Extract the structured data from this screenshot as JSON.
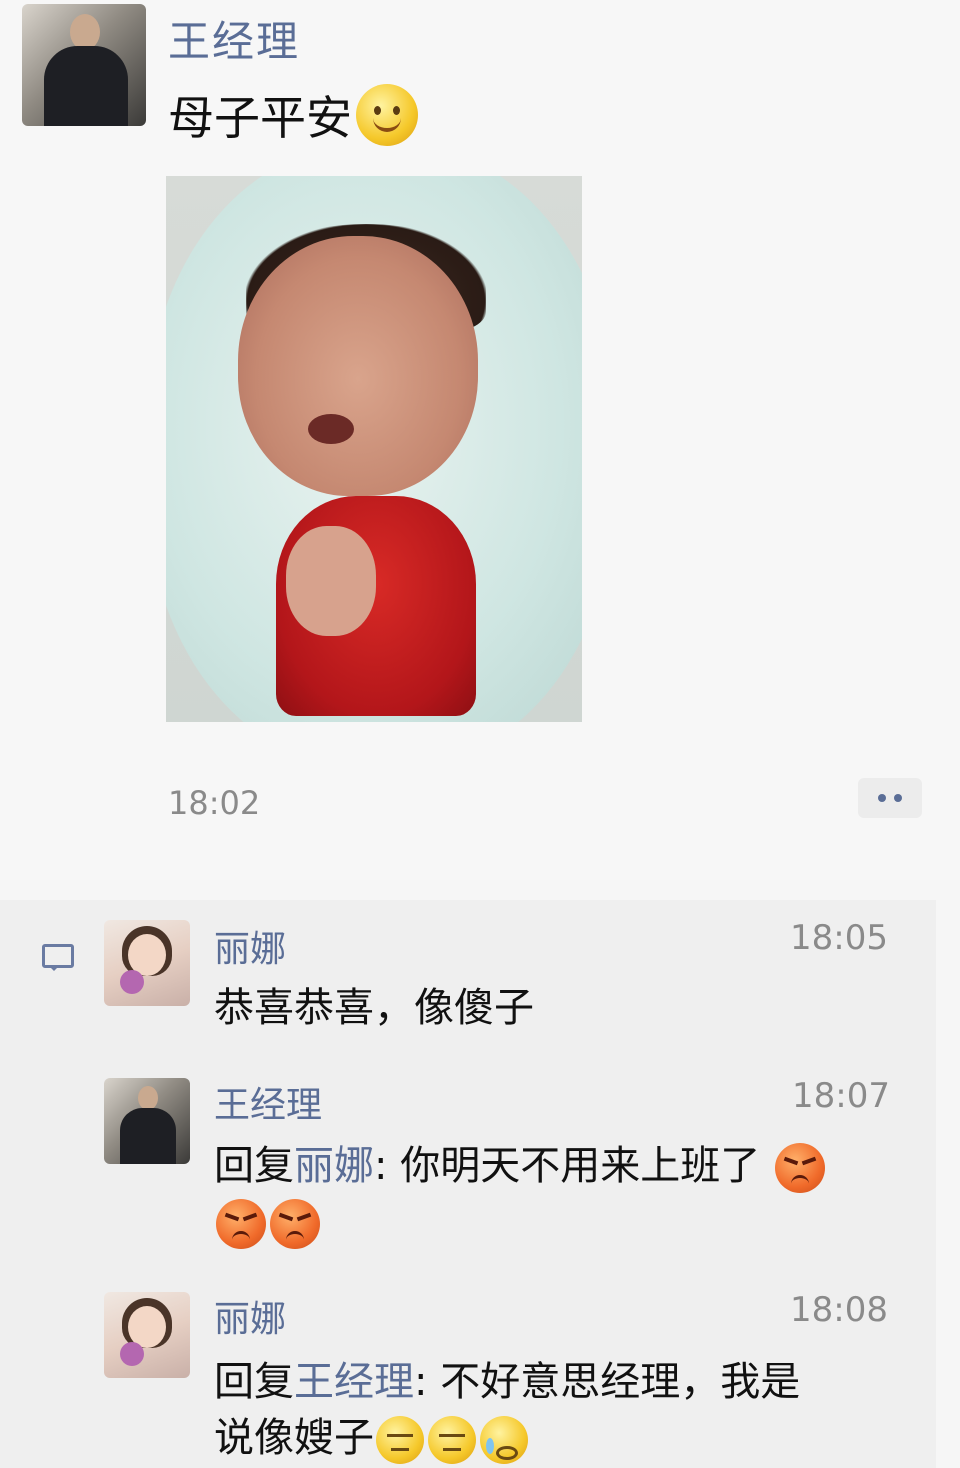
{
  "post": {
    "author": "王经理",
    "text": "母子平安",
    "text_emoji": "smile-emoji",
    "image": "newborn-baby-photo",
    "time": "18:02",
    "more_icon": "more-dots-icon"
  },
  "comments": [
    {
      "author": "丽娜",
      "time": "18:05",
      "text": "恭喜恭喜，像傻子"
    },
    {
      "author": "王经理",
      "time": "18:07",
      "reply_prefix": "回复",
      "reply_to": "丽娜",
      "text": ": 你明天不用来上班了",
      "emojis": [
        "angry-emoji",
        "angry-emoji",
        "angry-emoji"
      ]
    },
    {
      "author": "丽娜",
      "time": "18:08",
      "reply_prefix": "回复",
      "reply_to": "王经理",
      "text": ": 不好意思经理，我是",
      "text2": "说像嫂子",
      "emojis": [
        "meh-emoji",
        "grimace-emoji",
        "cry-emoji"
      ]
    }
  ],
  "colors": {
    "name_link": "#5a6d96",
    "background": "#f7f7f7",
    "comment_bg": "#efefef"
  }
}
